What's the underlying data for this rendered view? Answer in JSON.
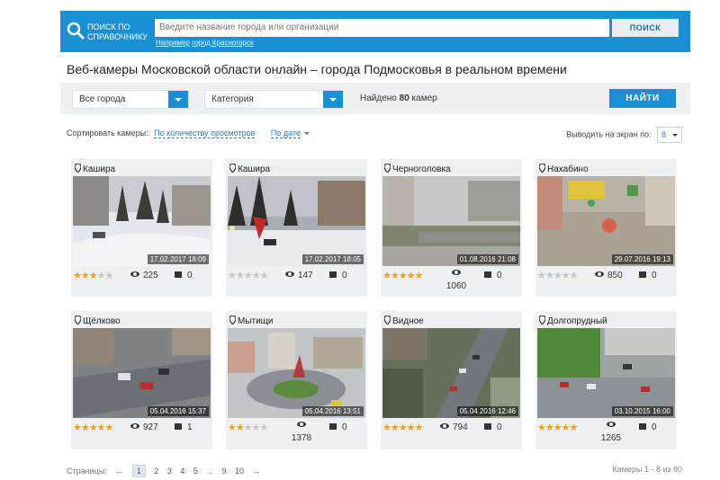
{
  "search": {
    "title_line1": "ПОИСК ПО",
    "title_line2": "СПРАВОЧНИКУ",
    "placeholder": "Введите название города или организации",
    "hint_prefix": "Например",
    "hint_example": "город Красногорск",
    "button": "ПОИСК"
  },
  "page_title": "Веб-камеры Московской области онлайн – города Подмосковья в реальном времени",
  "filter": {
    "city": "Все города",
    "category": "Категория",
    "found_prefix": "Найдено",
    "found_count": "80",
    "found_suffix": "камер",
    "button": "НАЙТИ"
  },
  "sort": {
    "label": "Сортировать камеры:",
    "by_views": "По количеству просмотров",
    "by_date": "По дате"
  },
  "per_page": {
    "label": "Выводить на экран по:",
    "value": "8"
  },
  "cameras": [
    {
      "city": "Кашира",
      "timestamp": "17.02.2017 18:09",
      "rating": 3,
      "views": "225",
      "comments": "0"
    },
    {
      "city": "Кашира",
      "timestamp": "17.02.2017 18:05",
      "rating": 0,
      "views": "147",
      "comments": "0"
    },
    {
      "city": "Черноголовка",
      "timestamp": "01.08.2016 21:08",
      "rating": 5,
      "views": "1060",
      "comments": "0"
    },
    {
      "city": "Нахабино",
      "timestamp": "29.07.2016 19:13",
      "rating": 0,
      "views": "850",
      "comments": "0"
    },
    {
      "city": "Щёлково",
      "timestamp": "05.04.2016 15:37",
      "rating": 5,
      "views": "927",
      "comments": "1"
    },
    {
      "city": "Мытищи",
      "timestamp": "05.04.2016 13:51",
      "rating": 2,
      "views": "1378",
      "comments": "0"
    },
    {
      "city": "Видное",
      "timestamp": "05.04.2016 12:46",
      "rating": 5,
      "views": "794",
      "comments": "0"
    },
    {
      "city": "Долгопрудный",
      "timestamp": "03.10.2015 16:00",
      "rating": 5,
      "views": "1265",
      "comments": "0"
    }
  ],
  "pagination": {
    "label": "Страницы:",
    "prev": "←",
    "pages": [
      "1",
      "2",
      "3",
      "4",
      "5",
      "...",
      "9",
      "10"
    ],
    "current": "1",
    "next": "→",
    "summary": "Камеры 1 - 8 из 80"
  },
  "colors": {
    "accent": "#1b8fd3",
    "star": "#f0a020",
    "panel": "#eef0f2"
  }
}
